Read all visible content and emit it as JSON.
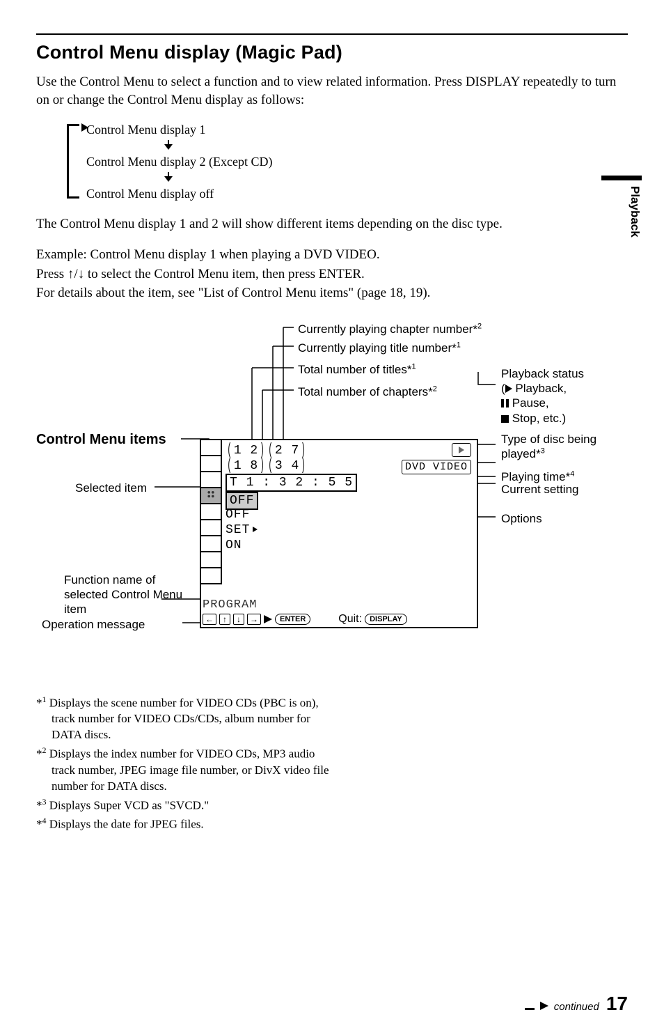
{
  "sidebar_tab": "Playback",
  "heading": "Control Menu display (Magic Pad)",
  "intro": "Use the Control Menu to select a function and to view related information. Press DISPLAY repeatedly to turn on or change the Control Menu display as follows:",
  "flow": {
    "line1": "Control Menu display 1",
    "line2": "Control Menu display 2 (Except CD)",
    "line3": "Control Menu display off"
  },
  "para2": "The Control Menu display 1 and 2 will show different items depending on the disc type.",
  "para3a": "Example: Control Menu display 1 when playing a DVD VIDEO.",
  "para3b": "Press ↑/↓ to select the Control Menu item, then press ENTER.",
  "para3c": "For details about the item, see \"List of Control Menu items\" (page 18, 19).",
  "diagram": {
    "cm_heading": "Control Menu items",
    "osd": {
      "r1a": "1 2",
      "r1b": "2 7",
      "r2a": "1 8",
      "r2b": "3 4",
      "r3": "T       1 : 3 2 : 5 5",
      "opt1": "OFF",
      "opt2": "OFF",
      "opt3": "SET",
      "opt4": "ON",
      "disc": "DVD VIDEO",
      "program": "PROGRAM",
      "enter": "ENTER",
      "quit": "Quit:",
      "display": "DISPLAY"
    },
    "labels": {
      "chapter_num": "Currently playing chapter number*",
      "title_num": "Currently playing title number*",
      "total_titles": "Total number of titles*",
      "total_chapters": "Total number of chapters*",
      "playback_status": "Playback status",
      "ps_play": " Playback,",
      "ps_pause": " Pause,",
      "ps_stop": " Stop, etc.)",
      "type_disc": "Type of disc being played*",
      "playing_time": "Playing time*",
      "current_setting": "Current setting",
      "options": "Options",
      "selected_item": "Selected item",
      "func_name": "Function name of selected Control Menu item",
      "op_msg": "Operation message"
    },
    "sups": {
      "one": "1",
      "two": "2",
      "three": "3",
      "four": "4"
    }
  },
  "footnotes": {
    "f1": " Displays the scene number for VIDEO CDs (PBC is on), track number for VIDEO CDs/CDs, album number for DATA discs.",
    "f2": " Displays the index number for VIDEO CDs, MP3 audio track number, JPEG image file number, or DivX video file number for DATA discs.",
    "f3": " Displays Super VCD as \"SVCD.\"",
    "f4": " Displays the date for JPEG files."
  },
  "footer": {
    "continued": "continued",
    "page": "17"
  }
}
